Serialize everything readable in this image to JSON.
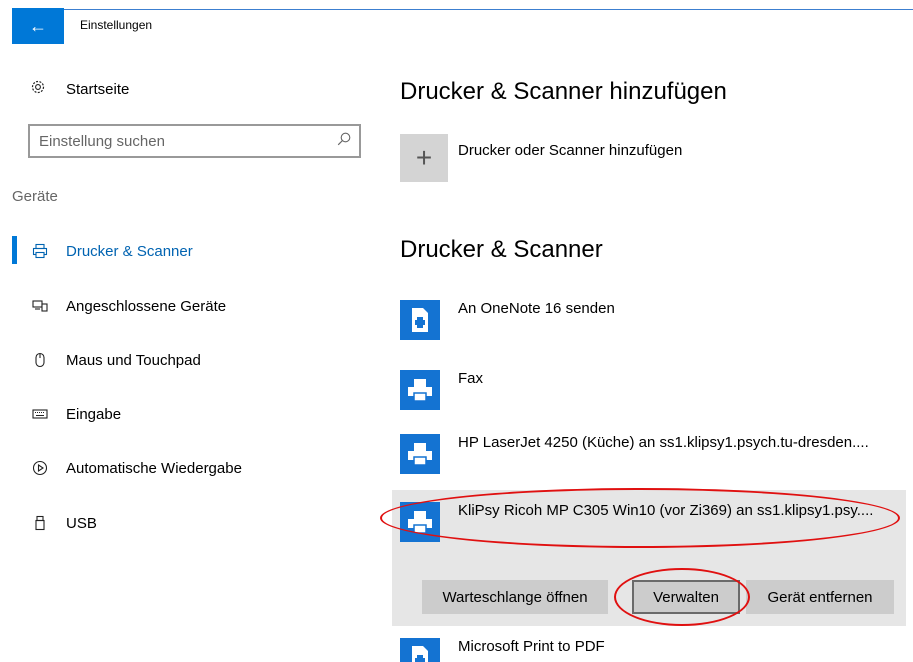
{
  "window": {
    "title": "Einstellungen",
    "back_icon": "←"
  },
  "sidebar": {
    "home_label": "Startseite",
    "search_placeholder": "Einstellung suchen",
    "section_label": "Geräte",
    "items": [
      {
        "label": "Drucker & Scanner",
        "icon": "printer-icon",
        "active": true
      },
      {
        "label": "Angeschlossene Geräte",
        "icon": "devices-icon",
        "active": false
      },
      {
        "label": "Maus und Touchpad",
        "icon": "mouse-icon",
        "active": false
      },
      {
        "label": "Eingabe",
        "icon": "keyboard-icon",
        "active": false
      },
      {
        "label": "Automatische Wiedergabe",
        "icon": "autoplay-icon",
        "active": false
      },
      {
        "label": "USB",
        "icon": "usb-icon",
        "active": false
      }
    ]
  },
  "main": {
    "add_section_title": "Drucker & Scanner hinzufügen",
    "add_button_label": "Drucker oder Scanner hinzufügen",
    "list_section_title": "Drucker & Scanner",
    "printers": [
      {
        "name": "An OneNote 16 senden"
      },
      {
        "name": "Fax"
      },
      {
        "name": "HP LaserJet 4250 (Küche) an ss1.klipsy1.psych.tu-dresden...."
      },
      {
        "name": "KliPsy Ricoh MP C305 Win10 (vor Zi369) an ss1.klipsy1.psy...."
      },
      {
        "name": "Microsoft Print to PDF"
      }
    ],
    "actions": {
      "queue_label": "Warteschlange öffnen",
      "manage_label": "Verwalten",
      "remove_label": "Gerät entfernen"
    }
  },
  "colors": {
    "accent": "#0078d7",
    "annotation": "#e01010"
  }
}
